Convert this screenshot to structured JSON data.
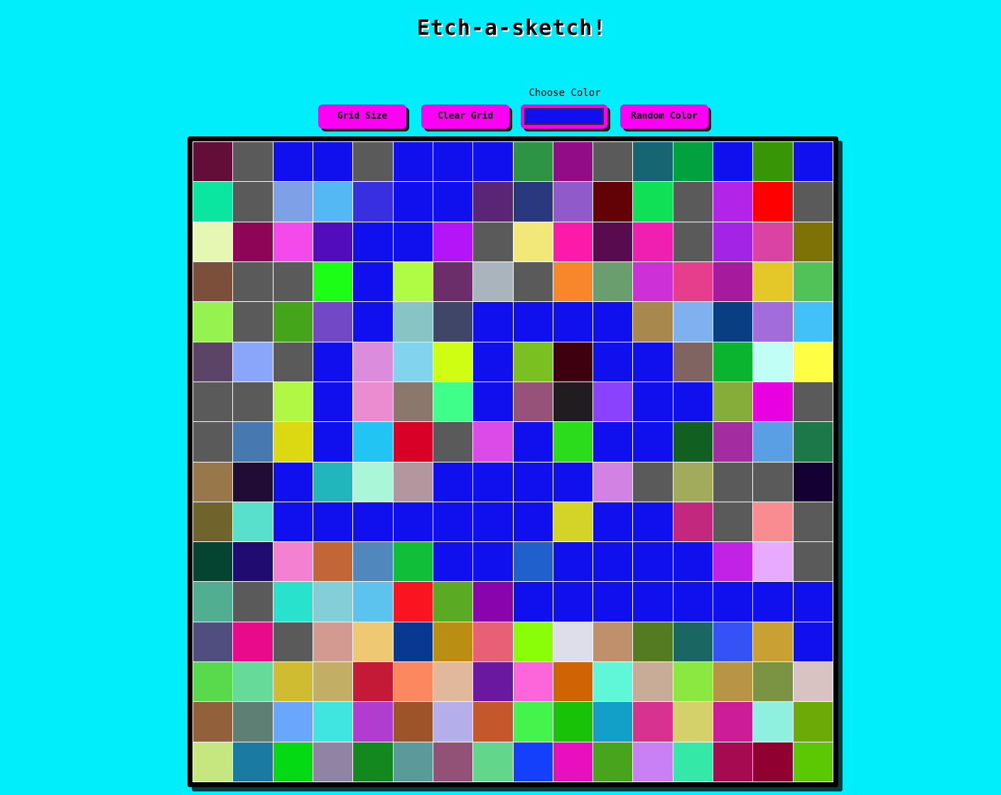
{
  "app": {
    "title": "Etch-a-sketch!"
  },
  "controls": {
    "grid_size_label": "Grid Size",
    "clear_grid_label": "Clear Grid",
    "choose_color_label": "Choose Color",
    "chosen_color": "#1010ee",
    "random_color_label": "Random Color"
  },
  "grid": {
    "size": 16,
    "cells": [
      [
        "#620e38",
        "#5a5a5a",
        "#1010ee",
        "#1010ee",
        "#5a5a5a",
        "#1010ee",
        "#1010ee",
        "#1010ee",
        "#2c9444",
        "#930c87",
        "#5a5a5a",
        "#156672",
        "#00a13e",
        "#1010ee",
        "#389506",
        "#1010ee"
      ],
      [
        "#0ae6a0",
        "#5a5a5a",
        "#7ea0e6",
        "#54b8f4",
        "#3830e0",
        "#1010ee",
        "#1010ee",
        "#5a2575",
        "#2a397d",
        "#905acb",
        "#620206",
        "#10e056",
        "#5a5a5a",
        "#b224e8",
        "#fe0000",
        "#5a5a5a"
      ],
      [
        "#e6f7b3",
        "#8e0456",
        "#f44aec",
        "#520cbc",
        "#1010ee",
        "#1010ee",
        "#b414f8",
        "#5a5a5a",
        "#f2e87a",
        "#fc1aaa",
        "#580c4f",
        "#f01fb2",
        "#5a5a5a",
        "#a424e6",
        "#da42a4",
        "#7e7206"
      ],
      [
        "#7b4f3a",
        "#5a5a5a",
        "#5a5a5a",
        "#1cfe16",
        "#1010ee",
        "#b0fc44",
        "#6c2d6b",
        "#aab4bc",
        "#5a5a5a",
        "#f8862a",
        "#6a9e6e",
        "#cc30d6",
        "#e63e8c",
        "#a61a9e",
        "#e4c82a",
        "#50c258"
      ],
      [
        "#96f24e",
        "#5a5a5a",
        "#44a41a",
        "#7248c6",
        "#1010ee",
        "#88c4c4",
        "#404668",
        "#1010ee",
        "#1010ee",
        "#1010ee",
        "#1010ee",
        "#a8884c",
        "#80b0f0",
        "#0a3e82",
        "#a26cda",
        "#42c0f8"
      ],
      [
        "#5c4466",
        "#8aa6fa",
        "#5a5a5a",
        "#1010ee",
        "#dc8cdc",
        "#82d4ee",
        "#d0fe12",
        "#1010ee",
        "#7ac020",
        "#3e000e",
        "#1010ee",
        "#1010ee",
        "#806462",
        "#0ab42e",
        "#c0fef6",
        "#fefe44"
      ],
      [
        "#5a5a5a",
        "#5a5a5a",
        "#b0f844",
        "#1010ee",
        "#ec8cd0",
        "#8a786c",
        "#40fe8a",
        "#1010ee",
        "#965278",
        "#201c20",
        "#8a42fc",
        "#1010ee",
        "#1010ee",
        "#86ac3a",
        "#e800e0",
        "#5a5a5a"
      ],
      [
        "#5a5a5a",
        "#4878b0",
        "#dcd812",
        "#1010ee",
        "#22c4f4",
        "#d80026",
        "#5a5a5a",
        "#dc4ae8",
        "#1010ee",
        "#2adc1c",
        "#1010ee",
        "#1010ee",
        "#116022",
        "#a22ca0",
        "#5a9ee4",
        "#1c7848"
      ],
      [
        "#98784a",
        "#200c34",
        "#1010ee",
        "#20b6bc",
        "#aaf6d8",
        "#b4969e",
        "#1010ee",
        "#1010ee",
        "#1010ee",
        "#1010ee",
        "#d282e2",
        "#5a5a5a",
        "#a2aa5c",
        "#5a5a5a",
        "#5a5a5a",
        "#140032"
      ],
      [
        "#6e642c",
        "#58e0cc",
        "#1010ee",
        "#1010ee",
        "#1010ee",
        "#1010ee",
        "#1010ee",
        "#1010ee",
        "#1010ee",
        "#d4d428",
        "#1010ee",
        "#1010ee",
        "#c2287e",
        "#5a5a5a",
        "#f88c90",
        "#5a5a5a"
      ],
      [
        "#044430",
        "#200c70",
        "#f480d2",
        "#c26638",
        "#5088be",
        "#10be3a",
        "#1010ee",
        "#1010ee",
        "#2060cc",
        "#1010ee",
        "#1010ee",
        "#1010ee",
        "#1010ee",
        "#c222e6",
        "#e8aafc",
        "#5a5a5a"
      ],
      [
        "#52ae90",
        "#5a5a5a",
        "#28e2ce",
        "#84ced8",
        "#5cc2ee",
        "#fa1420",
        "#5aaa24",
        "#8a04ae",
        "#1010ee",
        "#1010ee",
        "#1010ee",
        "#1010ee",
        "#1010ee",
        "#1010ee",
        "#1010ee",
        "#1010ee"
      ],
      [
        "#504e7e",
        "#e80a8a",
        "#5a5a5a",
        "#d29a90",
        "#eec872",
        "#083890",
        "#ba8e12",
        "#e86076",
        "#8afe08",
        "#dedeea",
        "#c0906c",
        "#547a22",
        "#1a6660",
        "#3452f6",
        "#c8a034",
        "#1010ee"
      ],
      [
        "#58da4c",
        "#66da98",
        "#d0bc30",
        "#c2ae64",
        "#c41a38",
        "#fc8860",
        "#e2b89c",
        "#6a18a0",
        "#fc66da",
        "#d06404",
        "#60f6d8",
        "#c8ac98",
        "#8ae840",
        "#b89446",
        "#7a9444",
        "#d8c2c2"
      ],
      [
        "#92603a",
        "#5e8074",
        "#6aa6fc",
        "#40e4e0",
        "#b03cd0",
        "#9c5428",
        "#b4aeea",
        "#c4582c",
        "#44f44c",
        "#18c206",
        "#12a0c8",
        "#d83290",
        "#d4d06a",
        "#cc1c98",
        "#90f0e0",
        "#6caa08"
      ],
      [
        "#c6e680",
        "#1a7aa2",
        "#04da14",
        "#9084a4",
        "#12881e",
        "#5a9a98",
        "#925278",
        "#62d68a",
        "#1440fc",
        "#e810be",
        "#48a41c",
        "#c880f4",
        "#34e8a8",
        "#a60a50",
        "#900030",
        "#5ac802"
      ]
    ]
  }
}
